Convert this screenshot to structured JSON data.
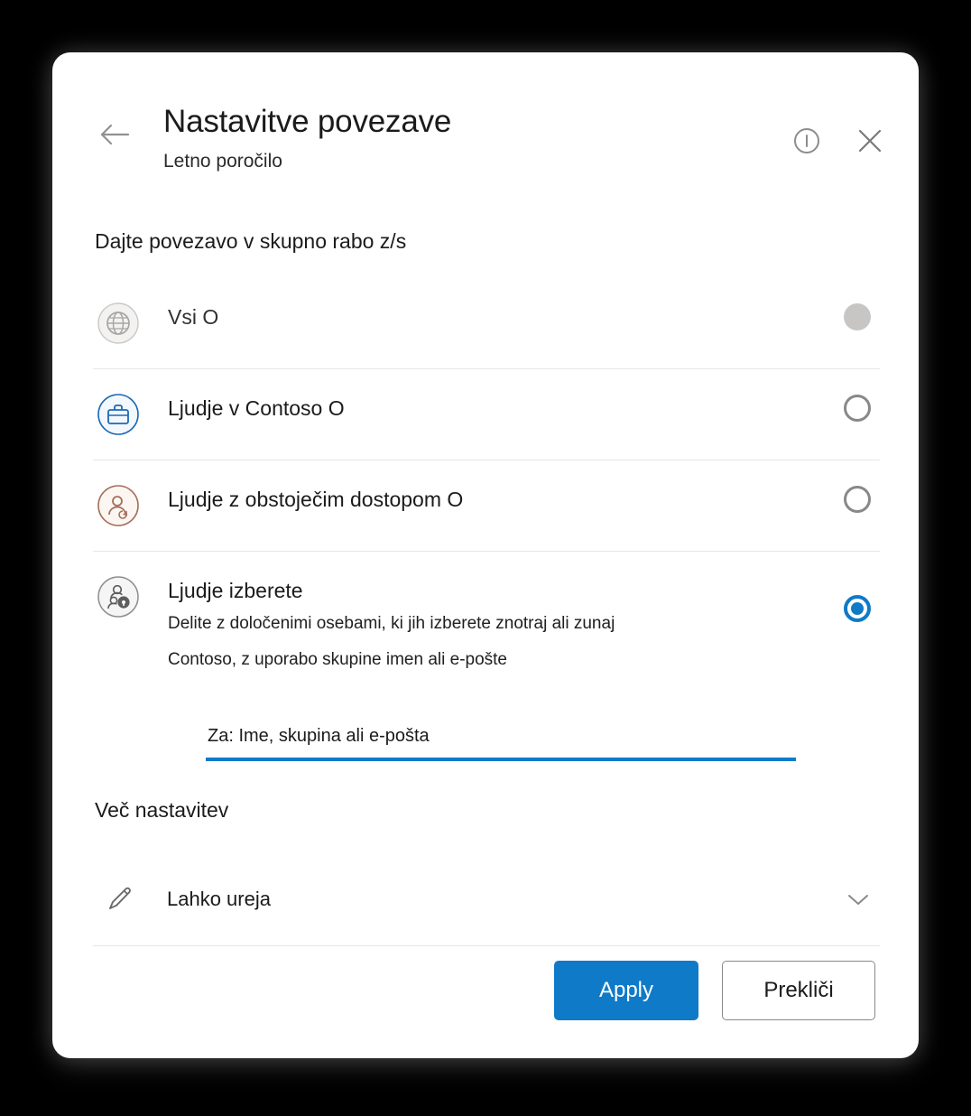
{
  "dialog": {
    "title": "Nastavitve povezave",
    "subtitle": "Letno poročilo",
    "back_icon": "arrow-left-icon",
    "info_icon": "info-circle-icon",
    "close_icon": "close-icon"
  },
  "share_section": {
    "heading": "Dajte povezavo v skupno rabo z/s",
    "options": [
      {
        "icon": "globe-icon",
        "label": "Vsi O",
        "description": "",
        "state": "disabled",
        "icon_color": "#a6a6a6"
      },
      {
        "icon": "briefcase-icon",
        "label": "Ljudje v Contoso O",
        "description": "",
        "state": "unselected",
        "icon_color": "#1b69b4"
      },
      {
        "icon": "person-clock-icon",
        "label": "Ljudje z obstoječim dostopom O",
        "description": "",
        "state": "unselected",
        "icon_color": "#a4705a"
      },
      {
        "icon": "people-lock-icon",
        "label": "Ljudje izberete",
        "description_line1": "Delite z določenimi osebami, ki jih izberete znotraj ali zunaj",
        "description_line2": "Contoso, z uporabo skupine imen ali e-pošte",
        "state": "selected",
        "icon_color": "#5e5e5e"
      }
    ]
  },
  "people_input": {
    "placeholder": "Za: Ime, skupina ali e-pošta",
    "value": ""
  },
  "more_settings": {
    "heading": "Več nastavitev",
    "icon": "pencil-icon",
    "selected_option": "Lahko ureja",
    "chevron_icon": "chevron-down-icon"
  },
  "footer": {
    "apply_label": "Apply",
    "cancel_label": "Prekliči"
  },
  "colors": {
    "accent": "#0f7ac8",
    "divider": "#e6e6e6",
    "text": "#1b1b1b"
  }
}
